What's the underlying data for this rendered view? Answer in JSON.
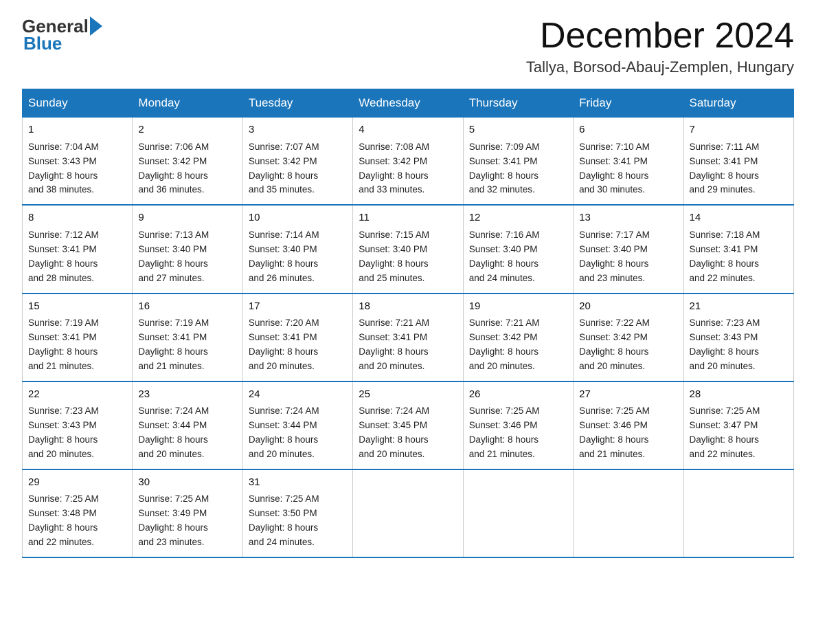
{
  "logo": {
    "general": "General",
    "blue": "Blue"
  },
  "title": "December 2024",
  "subtitle": "Tallya, Borsod-Abauj-Zemplen, Hungary",
  "days_of_week": [
    "Sunday",
    "Monday",
    "Tuesday",
    "Wednesday",
    "Thursday",
    "Friday",
    "Saturday"
  ],
  "weeks": [
    [
      {
        "day": "1",
        "sunrise": "7:04 AM",
        "sunset": "3:43 PM",
        "daylight": "8 hours and 38 minutes."
      },
      {
        "day": "2",
        "sunrise": "7:06 AM",
        "sunset": "3:42 PM",
        "daylight": "8 hours and 36 minutes."
      },
      {
        "day": "3",
        "sunrise": "7:07 AM",
        "sunset": "3:42 PM",
        "daylight": "8 hours and 35 minutes."
      },
      {
        "day": "4",
        "sunrise": "7:08 AM",
        "sunset": "3:42 PM",
        "daylight": "8 hours and 33 minutes."
      },
      {
        "day": "5",
        "sunrise": "7:09 AM",
        "sunset": "3:41 PM",
        "daylight": "8 hours and 32 minutes."
      },
      {
        "day": "6",
        "sunrise": "7:10 AM",
        "sunset": "3:41 PM",
        "daylight": "8 hours and 30 minutes."
      },
      {
        "day": "7",
        "sunrise": "7:11 AM",
        "sunset": "3:41 PM",
        "daylight": "8 hours and 29 minutes."
      }
    ],
    [
      {
        "day": "8",
        "sunrise": "7:12 AM",
        "sunset": "3:41 PM",
        "daylight": "8 hours and 28 minutes."
      },
      {
        "day": "9",
        "sunrise": "7:13 AM",
        "sunset": "3:40 PM",
        "daylight": "8 hours and 27 minutes."
      },
      {
        "day": "10",
        "sunrise": "7:14 AM",
        "sunset": "3:40 PM",
        "daylight": "8 hours and 26 minutes."
      },
      {
        "day": "11",
        "sunrise": "7:15 AM",
        "sunset": "3:40 PM",
        "daylight": "8 hours and 25 minutes."
      },
      {
        "day": "12",
        "sunrise": "7:16 AM",
        "sunset": "3:40 PM",
        "daylight": "8 hours and 24 minutes."
      },
      {
        "day": "13",
        "sunrise": "7:17 AM",
        "sunset": "3:40 PM",
        "daylight": "8 hours and 23 minutes."
      },
      {
        "day": "14",
        "sunrise": "7:18 AM",
        "sunset": "3:41 PM",
        "daylight": "8 hours and 22 minutes."
      }
    ],
    [
      {
        "day": "15",
        "sunrise": "7:19 AM",
        "sunset": "3:41 PM",
        "daylight": "8 hours and 21 minutes."
      },
      {
        "day": "16",
        "sunrise": "7:19 AM",
        "sunset": "3:41 PM",
        "daylight": "8 hours and 21 minutes."
      },
      {
        "day": "17",
        "sunrise": "7:20 AM",
        "sunset": "3:41 PM",
        "daylight": "8 hours and 20 minutes."
      },
      {
        "day": "18",
        "sunrise": "7:21 AM",
        "sunset": "3:41 PM",
        "daylight": "8 hours and 20 minutes."
      },
      {
        "day": "19",
        "sunrise": "7:21 AM",
        "sunset": "3:42 PM",
        "daylight": "8 hours and 20 minutes."
      },
      {
        "day": "20",
        "sunrise": "7:22 AM",
        "sunset": "3:42 PM",
        "daylight": "8 hours and 20 minutes."
      },
      {
        "day": "21",
        "sunrise": "7:23 AM",
        "sunset": "3:43 PM",
        "daylight": "8 hours and 20 minutes."
      }
    ],
    [
      {
        "day": "22",
        "sunrise": "7:23 AM",
        "sunset": "3:43 PM",
        "daylight": "8 hours and 20 minutes."
      },
      {
        "day": "23",
        "sunrise": "7:24 AM",
        "sunset": "3:44 PM",
        "daylight": "8 hours and 20 minutes."
      },
      {
        "day": "24",
        "sunrise": "7:24 AM",
        "sunset": "3:44 PM",
        "daylight": "8 hours and 20 minutes."
      },
      {
        "day": "25",
        "sunrise": "7:24 AM",
        "sunset": "3:45 PM",
        "daylight": "8 hours and 20 minutes."
      },
      {
        "day": "26",
        "sunrise": "7:25 AM",
        "sunset": "3:46 PM",
        "daylight": "8 hours and 21 minutes."
      },
      {
        "day": "27",
        "sunrise": "7:25 AM",
        "sunset": "3:46 PM",
        "daylight": "8 hours and 21 minutes."
      },
      {
        "day": "28",
        "sunrise": "7:25 AM",
        "sunset": "3:47 PM",
        "daylight": "8 hours and 22 minutes."
      }
    ],
    [
      {
        "day": "29",
        "sunrise": "7:25 AM",
        "sunset": "3:48 PM",
        "daylight": "8 hours and 22 minutes."
      },
      {
        "day": "30",
        "sunrise": "7:25 AM",
        "sunset": "3:49 PM",
        "daylight": "8 hours and 23 minutes."
      },
      {
        "day": "31",
        "sunrise": "7:25 AM",
        "sunset": "3:50 PM",
        "daylight": "8 hours and 24 minutes."
      },
      null,
      null,
      null,
      null
    ]
  ],
  "labels": {
    "sunrise": "Sunrise: ",
    "sunset": "Sunset: ",
    "daylight": "Daylight: "
  }
}
